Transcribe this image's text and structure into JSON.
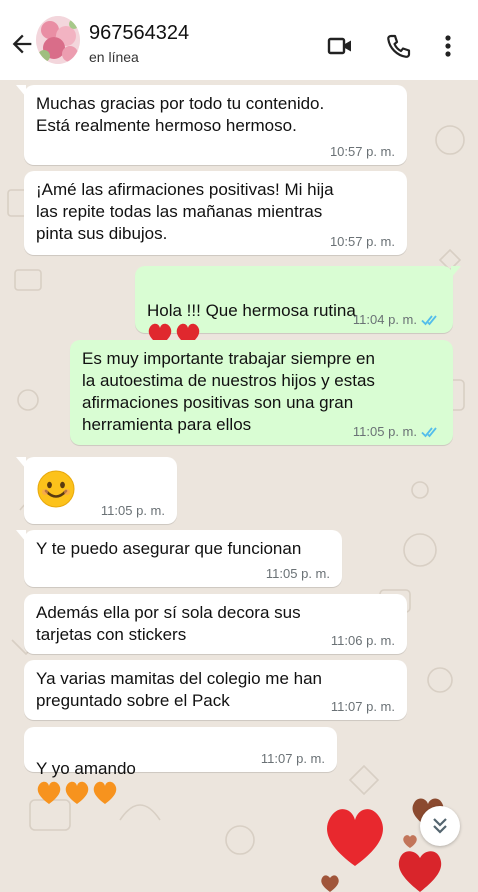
{
  "header": {
    "contact_name": "967564324",
    "status": "en línea"
  },
  "icons": {
    "back": "arrow-left-icon",
    "video": "video-call-icon",
    "phone": "phone-icon",
    "menu": "more-vertical-icon",
    "scroll": "double-chevron-down-icon",
    "ticks": "double-check-icon"
  },
  "colors": {
    "chat_background": "#ece5dd",
    "incoming_bubble": "#ffffff",
    "outgoing_bubble": "#d9fdd3",
    "read_ticks": "#53bdeb"
  },
  "messages": [
    {
      "direction": "in",
      "text": "Muchas gracias por todo tu contenido.\nEstá realmente hermoso hermoso.",
      "time": "10:57 p. m."
    },
    {
      "direction": "in",
      "text": "¡Amé las afirmaciones positivas! Mi hija\nlas repite todas las mañanas mientras\npinta sus dibujos.",
      "time": "10:57 p. m."
    },
    {
      "direction": "out",
      "text": "Hola !!! Que hermosa rutina",
      "time": "11:04 p. m.",
      "read": true
    },
    {
      "direction": "out",
      "text": "Es muy importante trabajar siempre en\nla autoestima de nuestros hijos y estas\nafirmaciones positivas son una gran\nherramienta para ellos",
      "time": "11:05 p. m.",
      "read": true
    },
    {
      "direction": "in",
      "text": "",
      "time": "11:05 p. m."
    },
    {
      "direction": "in",
      "text": "Y te puedo asegurar que funcionan",
      "time": "11:05 p. m."
    },
    {
      "direction": "in",
      "text": "Además ella por sí sola decora sus\ntarjetas con stickers",
      "time": "11:06 p. m."
    },
    {
      "direction": "in",
      "text": "Ya varias mamitas del colegio me han\npreguntado sobre el Pack",
      "time": "11:07 p. m."
    },
    {
      "direction": "in",
      "text": "Y yo amando",
      "time": "11:07 p. m."
    }
  ]
}
